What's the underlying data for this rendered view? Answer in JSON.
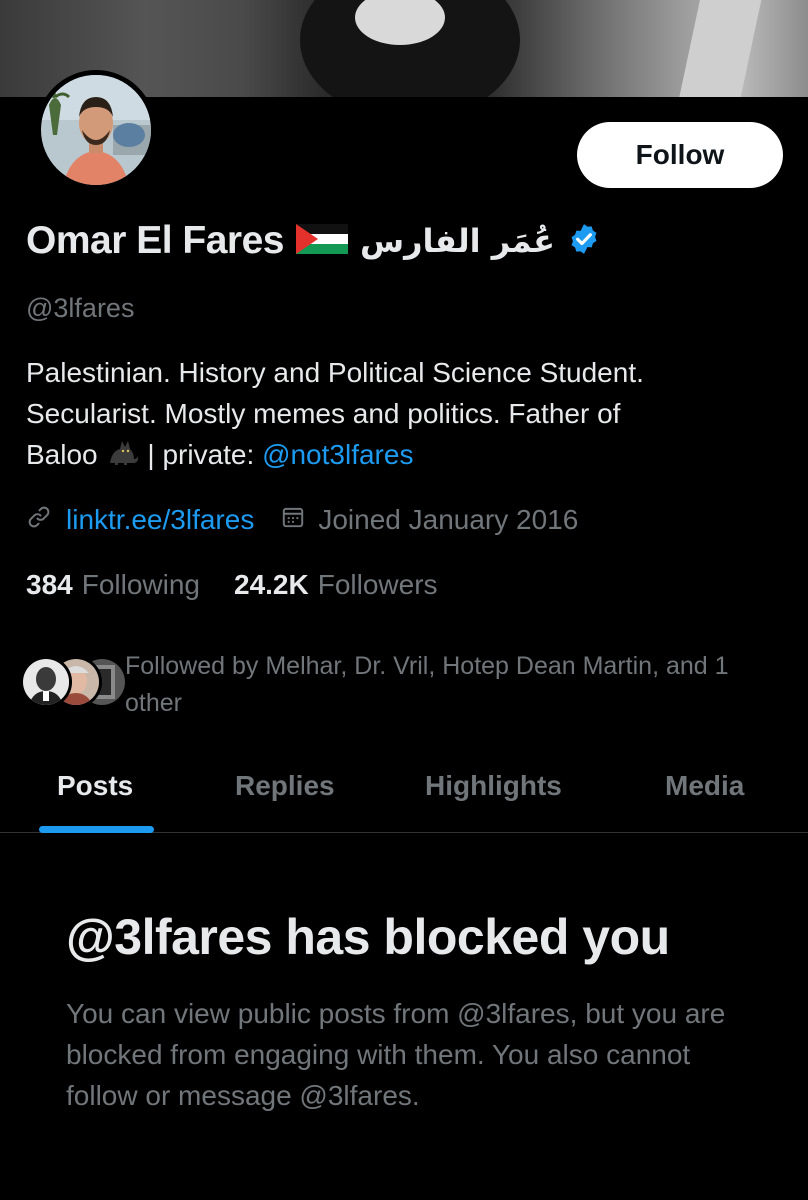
{
  "profile": {
    "display_name": "Omar El Fares",
    "arabic_name": "عُمَر الفارس",
    "handle": "@3lfares",
    "verified": true,
    "bio": {
      "line1": "Palestinian. History and Political Science Student.",
      "line2": "Secularist. Mostly memes and politics. Father of",
      "line3_prefix": "Baloo",
      "line3_mid": " | private: ",
      "mention": "@not3lfares"
    },
    "website": "linktr.ee/3lfares",
    "joined": "Joined January 2016",
    "following_count": "384",
    "following_label": "Following",
    "followers_count": "24.2K",
    "followers_label": "Followers",
    "followed_by": "Followed by Melhar, Dr. Vril, Hotep Dean Martin, and 1 other"
  },
  "actions": {
    "follow_label": "Follow"
  },
  "tabs": [
    {
      "label": "Posts",
      "active": true
    },
    {
      "label": "Replies",
      "active": false
    },
    {
      "label": "Highlights",
      "active": false
    },
    {
      "label": "Media",
      "active": false
    }
  ],
  "blocked": {
    "title": "@3lfares has blocked you",
    "body": "You can view public posts from @3lfares, but you are blocked from engaging with them. You also cannot follow or message @3lfares."
  },
  "colors": {
    "background": "#000000",
    "primary_text": "#e7e9ea",
    "secondary_text": "#71767b",
    "accent": "#1d9bf0",
    "divider": "#2f3336"
  },
  "icons": [
    "link-icon",
    "calendar-icon",
    "verified-badge-icon",
    "palestine-flag-icon",
    "cat-icon"
  ]
}
